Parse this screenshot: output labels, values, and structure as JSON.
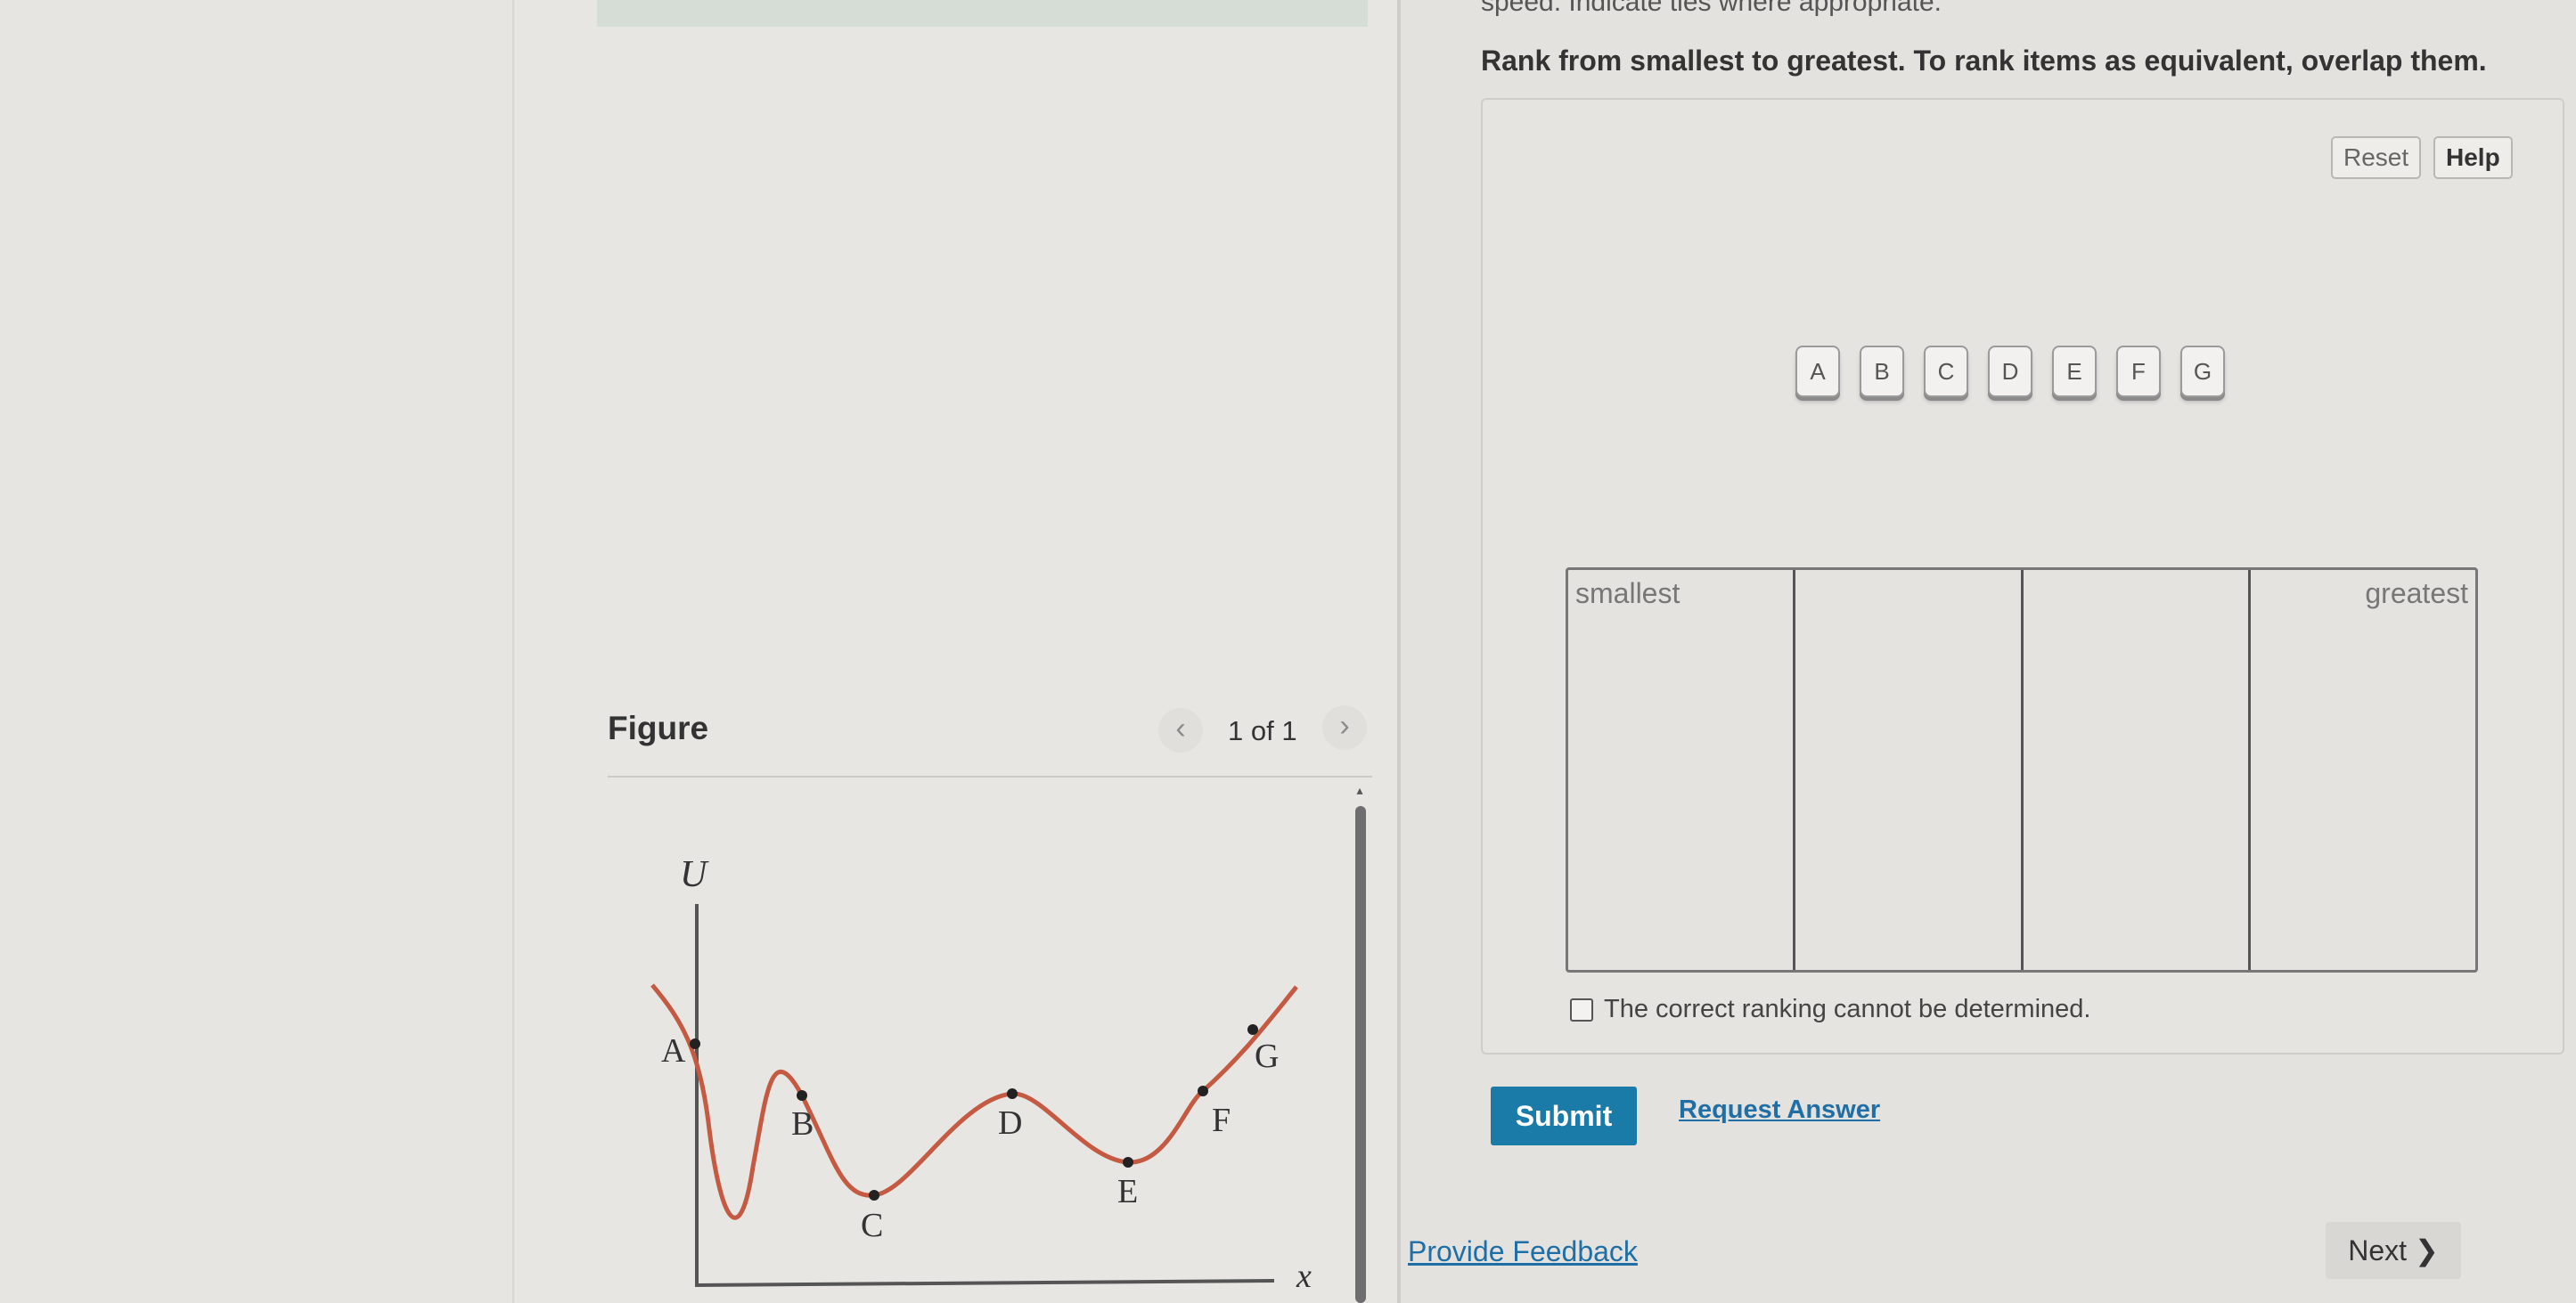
{
  "question": {
    "intro_fragment": "speed. Indicate ties where appropriate.",
    "instruction": "Rank from smallest to greatest. To rank items as equivalent, overlap them."
  },
  "controls": {
    "reset_label": "Reset",
    "help_label": "Help"
  },
  "items": [
    "A",
    "B",
    "C",
    "D",
    "E",
    "F",
    "G"
  ],
  "ranking": {
    "smallest_label": "smallest",
    "greatest_label": "greatest"
  },
  "cannot_determine": {
    "label": "The correct ranking cannot be determined.",
    "checked": false
  },
  "actions": {
    "submit_label": "Submit",
    "request_answer_label": "Request Answer",
    "provide_feedback_label": "Provide Feedback",
    "next_label": "Next"
  },
  "figure": {
    "title": "Figure",
    "counter": "1 of 1",
    "y_axis_label": "U",
    "x_axis_label": "x",
    "point_labels": [
      "A",
      "B",
      "C",
      "D",
      "E",
      "F",
      "G"
    ]
  },
  "colors": {
    "curve": "#c55a43",
    "submit": "#1a7aa8",
    "link": "#1f6fa6"
  }
}
